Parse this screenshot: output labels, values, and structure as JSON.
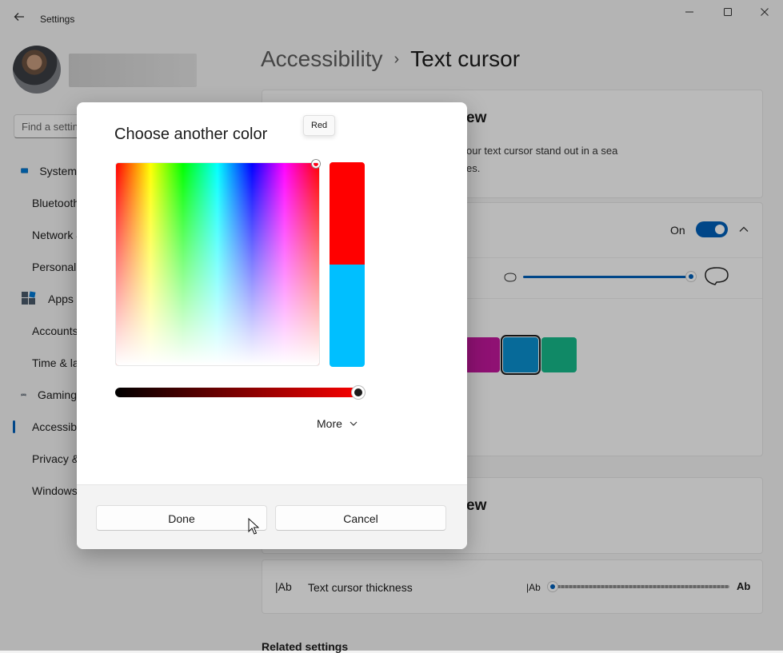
{
  "window": {
    "title": "Settings"
  },
  "breadcrumb": {
    "root": "Accessibility",
    "separator": "›",
    "leaf": "Text cursor"
  },
  "search": {
    "placeholder": "Find a setting"
  },
  "sidebar": {
    "items": [
      {
        "label": "System",
        "icon": "system-icon",
        "active": false
      },
      {
        "label": "Bluetooth & devices",
        "icon": "bluetooth-icon",
        "active": false
      },
      {
        "label": "Network & internet",
        "icon": "network-icon",
        "active": false
      },
      {
        "label": "Personalization",
        "icon": "brush-icon",
        "active": false
      },
      {
        "label": "Apps",
        "icon": "apps-icon",
        "active": false
      },
      {
        "label": "Accounts",
        "icon": "account-icon",
        "active": false
      },
      {
        "label": "Time & language",
        "icon": "clock-icon",
        "active": false
      },
      {
        "label": "Gaming",
        "icon": "gamepad-icon",
        "active": false
      },
      {
        "label": "Accessibility",
        "icon": "accessibility-icon",
        "active": true
      },
      {
        "label": "Privacy & security",
        "icon": "shield-icon",
        "active": false
      },
      {
        "label": "Windows Update",
        "icon": "update-icon",
        "active": false
      }
    ]
  },
  "main": {
    "preview_title_partial": "ew",
    "preview_desc_line1": "our text cursor stand out in a sea",
    "preview_desc_line2": "es.",
    "indicator": {
      "toggle_state": "On"
    },
    "swatches": [
      {
        "color": "#c2189c",
        "selected": false
      },
      {
        "color": "#0a8fcf",
        "selected": true
      },
      {
        "color": "#16b98a",
        "selected": false
      }
    ],
    "preview2_title_partial": "ew",
    "thickness": {
      "icon_text": "|Ab",
      "label": "Text cursor thickness",
      "small_text": "|Ab",
      "large_text": "Ab"
    },
    "related_settings": "Related settings"
  },
  "dialog": {
    "title": "Choose another color",
    "tooltip": "Red",
    "new_color": "#ff0000",
    "old_color": "#00bfff",
    "more_label": "More",
    "done_label": "Done",
    "cancel_label": "Cancel"
  },
  "colors": {
    "accent": "#005fb8",
    "hue_red": "#ff0000"
  }
}
